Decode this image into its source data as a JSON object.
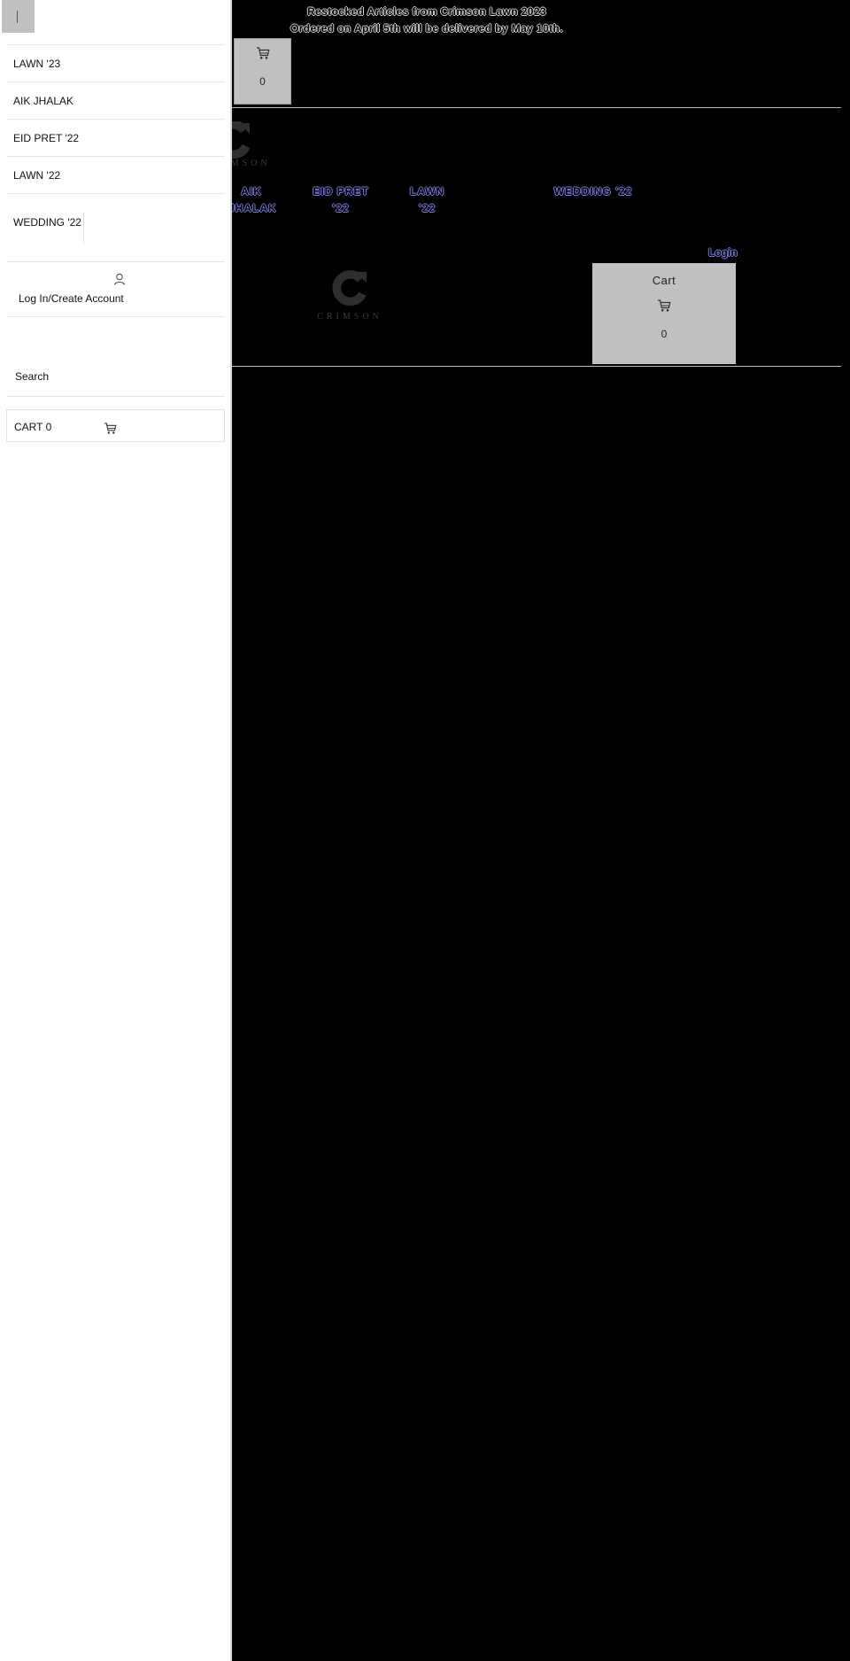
{
  "announcement": {
    "line1": "Restocked Articles from Crimson Lawn 2023",
    "line2": "Ordered on April 5th will be delivered by May 10th."
  },
  "header": {
    "top_cart_count": "0",
    "brand_text": "CRIMSON",
    "nav": [
      {
        "label": "AIK JHALAK"
      },
      {
        "label": "EID PRET '22"
      },
      {
        "label": "LAWN '22"
      },
      {
        "label": "WEDDING '22"
      }
    ],
    "login_label": "Login",
    "cart_label": "Cart",
    "cart_count": "0"
  },
  "drawer": {
    "close_icon": "close-icon",
    "menu": [
      {
        "label": "LAWN '23"
      },
      {
        "label": "AIK JHALAK"
      },
      {
        "label": "EID PRET '22"
      },
      {
        "label": "LAWN '22"
      },
      {
        "label": "WEDDING '22"
      }
    ],
    "account_label": "Log In/Create Account",
    "search_label": "Search",
    "cart_label": "CART 0"
  },
  "colors": {
    "drawer_bg": "#ffffff",
    "page_bg": "#000000",
    "button_gray": "#c0c0c0",
    "link_blue": "#7a7ae0"
  }
}
